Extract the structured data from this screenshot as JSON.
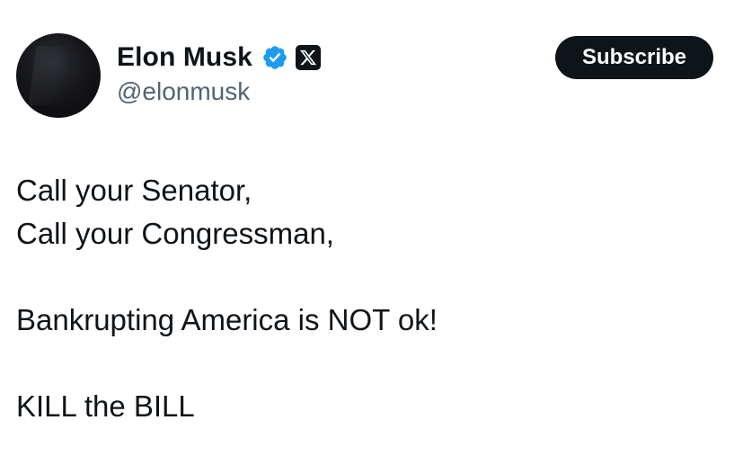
{
  "author": {
    "display_name": "Elon Musk",
    "handle": "@elonmusk",
    "verified": true,
    "affiliate_badge": "x-logo-icon",
    "avatar": "avatar-image"
  },
  "actions": {
    "subscribe_label": "Subscribe"
  },
  "tweet": {
    "lines": [
      "Call your Senator,",
      "Call your Congressman,",
      "",
      "Bankrupting America is NOT ok!",
      "",
      "KILL the BILL"
    ]
  },
  "colors": {
    "text_primary": "#0f1419",
    "text_secondary": "#536471",
    "verified_blue": "#1d9bf0",
    "button_bg": "#0f1419",
    "button_text": "#ffffff"
  }
}
